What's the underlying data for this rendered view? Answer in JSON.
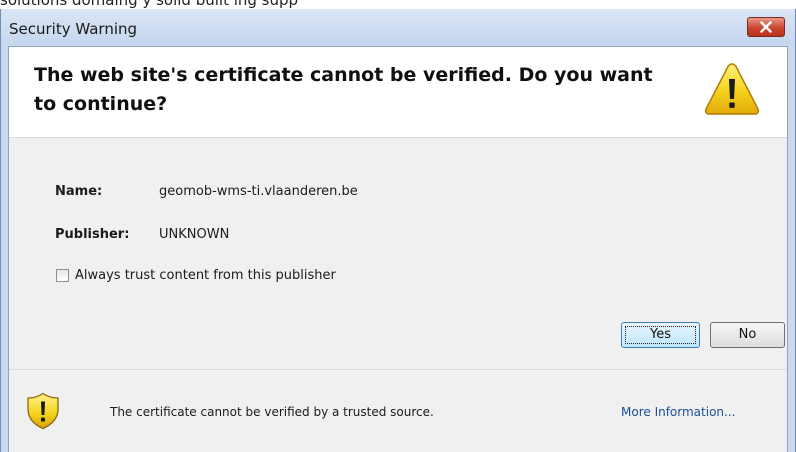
{
  "background": {
    "partial_text": "solutions      domaing y solid         built  ing            supp"
  },
  "window": {
    "title": "Security Warning"
  },
  "header": {
    "message": "The web site's certificate cannot be verified. Do you want to continue?"
  },
  "details": {
    "name_label": "Name:",
    "name_value": "geomob-wms-ti.vlaanderen.be",
    "publisher_label": "Publisher:",
    "publisher_value": "UNKNOWN"
  },
  "trust_checkbox": {
    "label": "Always trust content from this publisher",
    "checked": false
  },
  "buttons": {
    "yes_label": "Yes",
    "no_label": "No"
  },
  "footer": {
    "message": "The certificate cannot be verified by a trusted source.",
    "more_info_link": "More Information..."
  },
  "icons": {
    "close": "close-icon",
    "header_warning": "warning-triangle-icon",
    "footer_warning": "warning-shield-icon"
  },
  "colors": {
    "close_button": "#c9462f",
    "warning_yellow": "#f4d21b",
    "link": "#1b4f9c",
    "title_bar": "#c9d9ee"
  }
}
